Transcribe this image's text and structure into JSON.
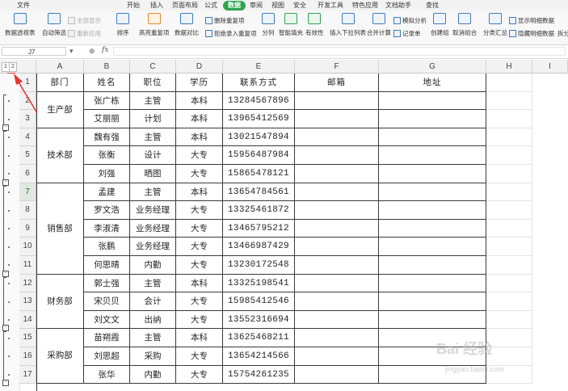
{
  "menu": [
    "文件",
    "开始",
    "插入",
    "页面布局",
    "公式",
    "数据",
    "审阅",
    "视图",
    "安全",
    "开发工具",
    "特色应用",
    "文档助手",
    "查找"
  ],
  "menu_active": "数据",
  "ribbon": {
    "pivot": "数据透视表",
    "autofilter": "自动筛选",
    "show_all": "全部显示",
    "reapply": "重新应用",
    "sort": "排序",
    "highlight_dup": "高亮重复项",
    "data_compare": "数据对比",
    "remove_dup": "删除重复项",
    "reject_dup": "拒绝录入重复项",
    "split": "分列",
    "smart_fill": "智能填充",
    "validity": "有效性",
    "insert_dropdown": "插入下拉列表",
    "consolidate": "合并计算",
    "what_if": "模拟分析",
    "record_form": "记录单",
    "group": "创建组",
    "ungroup": "取消组合",
    "subtotal": "分类汇总",
    "show_detail": "显示明细数据",
    "hide_detail": "隐藏明细数据",
    "split2": "拆分"
  },
  "formula_bar": {
    "name_box": "J7",
    "fx": "fx",
    "value": ""
  },
  "outline_levels": [
    "1",
    "2"
  ],
  "columns": [
    "A",
    "B",
    "C",
    "D",
    "E",
    "F",
    "G",
    "H",
    "I"
  ],
  "headers": [
    "部门",
    "姓名",
    "职位",
    "学历",
    "联系方式",
    "邮箱",
    "地址"
  ],
  "rows": [
    [
      "1"
    ],
    [
      "2",
      "",
      "张广栋",
      "主管",
      "本科",
      "13284567896"
    ],
    [
      "3",
      "",
      "艾丽丽",
      "计划",
      "本科",
      "13965412569"
    ],
    [
      "4",
      "",
      "魏有强",
      "主管",
      "本科",
      "13021547894"
    ],
    [
      "5",
      "",
      "张衡",
      "设计",
      "大专",
      "15956487984"
    ],
    [
      "6",
      "",
      "刘强",
      "晒图",
      "大专",
      "15865478121"
    ],
    [
      "7",
      "",
      "孟建",
      "主管",
      "本科",
      "13654784561"
    ],
    [
      "8",
      "",
      "罗文浩",
      "业务经理",
      "大专",
      "13325461872"
    ],
    [
      "9",
      "",
      "李淑清",
      "业务经理",
      "大专",
      "13465795212"
    ],
    [
      "10",
      "",
      "张鹏",
      "业务经理",
      "大专",
      "13466987429"
    ],
    [
      "11",
      "",
      "何思晴",
      "内勤",
      "大专",
      "13230172548"
    ],
    [
      "12",
      "",
      "郭士强",
      "主管",
      "本科",
      "13325198541"
    ],
    [
      "13",
      "",
      "宋贝贝",
      "会计",
      "大专",
      "15985412546"
    ],
    [
      "14",
      "",
      "刘文文",
      "出纳",
      "大专",
      "13552316694"
    ],
    [
      "15",
      "",
      "苗朔霞",
      "主管",
      "本科",
      "13625468211"
    ],
    [
      "16",
      "",
      "刘思超",
      "采购",
      "大专",
      "13654214566"
    ],
    [
      "17",
      "",
      "张华",
      "内勤",
      "大专",
      "15754261235"
    ]
  ],
  "departments": [
    "生产部",
    "技术部",
    "销售部",
    "财务部",
    "采购部"
  ],
  "watermark": {
    "logo": "Bai 经验",
    "url": "jingyan.baidu.com"
  },
  "colors": {
    "accent": "#2ea44f",
    "annotation": "#e53935"
  }
}
